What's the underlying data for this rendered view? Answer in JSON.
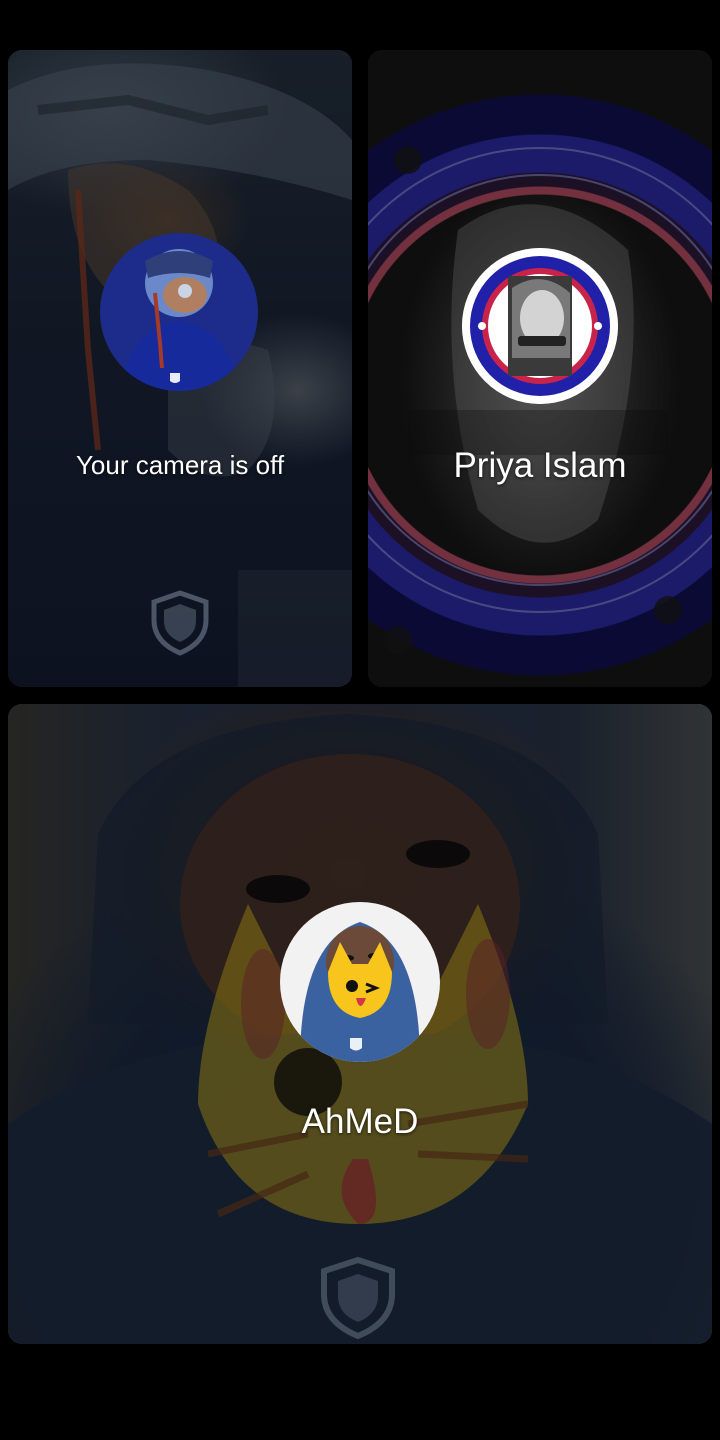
{
  "participants": {
    "self": {
      "status": "Your camera is off",
      "avatar": "avatar-photo",
      "badge_icon": "shield-icon"
    },
    "priya": {
      "name": "Priya Islam",
      "avatar": "avatar-emblem"
    },
    "ahmed": {
      "name": "AhMeD",
      "avatar": "avatar-photo",
      "badge_icon": "shield-icon"
    }
  },
  "colors": {
    "background": "#000000",
    "text": "#ffffff",
    "emblem_blue": "#2a2aa3",
    "sticker_yellow": "#d4b419"
  }
}
